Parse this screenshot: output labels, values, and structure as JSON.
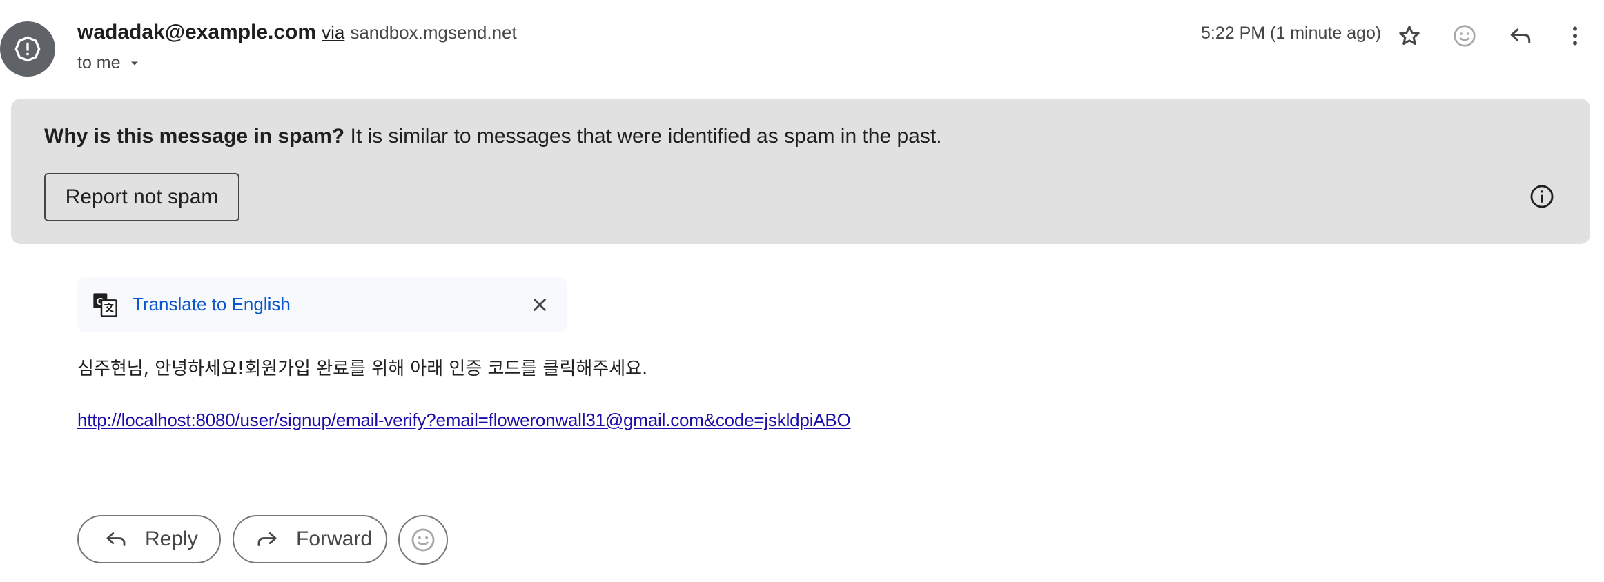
{
  "header": {
    "sender_email": "wadadak@example.com",
    "via_word": "via",
    "via_domain": "sandbox.mgsend.net",
    "recipient_label": "to me",
    "timestamp": "5:22 PM (1 minute ago)"
  },
  "icons": {
    "avatar": "alert-circle-icon",
    "star": "star-icon",
    "emoji": "emoji-reaction-icon",
    "reply": "reply-icon",
    "more": "more-vert-icon",
    "info": "info-icon",
    "translate": "translate-icon",
    "close": "close-icon",
    "forward": "forward-icon"
  },
  "spam_banner": {
    "question": "Why is this message in spam?",
    "explanation": "It is similar to messages that were identified as spam in the past.",
    "report_button": "Report not spam"
  },
  "translate": {
    "link_label": "Translate to English"
  },
  "message": {
    "body": "심주현님, 안녕하세요!회원가입 완료를 위해 아래 인증 코드를 클릭해주세요.",
    "link": "http://localhost:8080/user/signup/email-verify?email=floweronwall31@gmail.com&code=jskldpiABO"
  },
  "actions": {
    "reply_label": "Reply",
    "forward_label": "Forward"
  },
  "colors": {
    "banner_bg": "#e1e1e1",
    "avatar_bg": "#5f6368",
    "link": "#1a0dab",
    "translate_link": "#0b57d0"
  }
}
